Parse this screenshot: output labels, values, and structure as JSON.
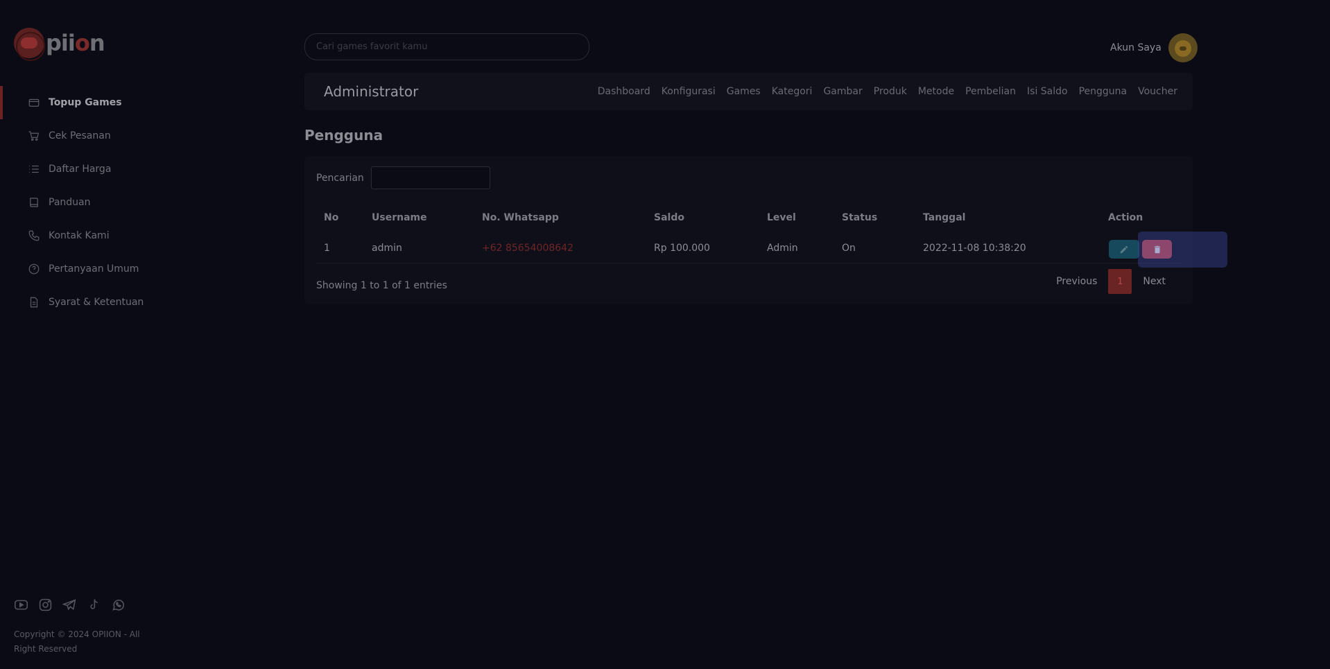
{
  "brand": {
    "logo_text_prefix": "pii",
    "logo_text_o": "o",
    "logo_text_suffix": "n"
  },
  "sidebar": {
    "items": [
      {
        "label": "Topup Games",
        "icon": "card-icon",
        "active": true
      },
      {
        "label": "Cek Pesanan",
        "icon": "cart-icon"
      },
      {
        "label": "Daftar Harga",
        "icon": "list-icon"
      },
      {
        "label": "Panduan",
        "icon": "book-icon"
      },
      {
        "label": "Kontak Kami",
        "icon": "phone-icon"
      },
      {
        "label": "Pertanyaan Umum",
        "icon": "question-icon"
      },
      {
        "label": "Syarat & Ketentuan",
        "icon": "document-icon"
      }
    ],
    "socials": [
      "youtube-icon",
      "instagram-icon",
      "telegram-icon",
      "tiktok-icon",
      "whatsapp-icon"
    ],
    "copyright": "Copyright © 2024 OPIION - All Right Reserved"
  },
  "header": {
    "search_placeholder": "Cari games favorit kamu",
    "account_label": "Akun Saya"
  },
  "admin_bar": {
    "title": "Administrator",
    "links": [
      "Dashboard",
      "Konfigurasi",
      "Games",
      "Kategori",
      "Gambar",
      "Produk",
      "Metode",
      "Pembelian",
      "Isi Saldo",
      "Pengguna",
      "Voucher"
    ]
  },
  "page": {
    "title": "Pengguna"
  },
  "filter": {
    "label": "Pencarian"
  },
  "table": {
    "headers": [
      "No",
      "Username",
      "No. Whatsapp",
      "Saldo",
      "Level",
      "Status",
      "Tanggal",
      "Action"
    ],
    "rows": [
      {
        "no": "1",
        "username": "admin",
        "whatsapp": "+62 85654008642",
        "saldo": "Rp 100.000",
        "level": "Admin",
        "status": "On",
        "tanggal": "2022-11-08 10:38:20"
      }
    ]
  },
  "footer": {
    "showing": "Showing 1 to 1 of 1 entries",
    "previous": "Previous",
    "current_page": "1",
    "next": "Next"
  },
  "colors": {
    "background": "#0b0b15",
    "accent": "#6b2424",
    "delete": "#d14a4a",
    "edit": "#16495c"
  }
}
